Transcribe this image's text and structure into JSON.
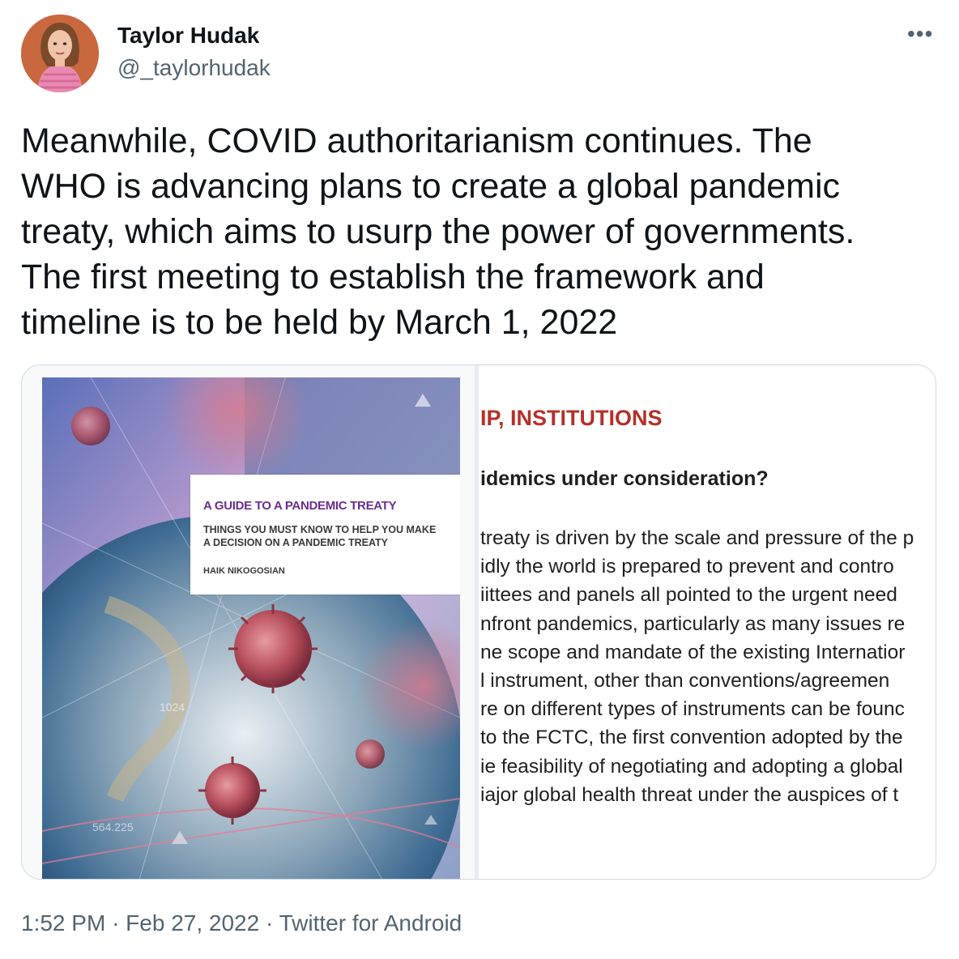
{
  "author": {
    "display_name": "Taylor Hudak",
    "handle": "@_taylorhudak"
  },
  "more_icon": "•••",
  "tweet_text_lines": [
    "Meanwhile, COVID authoritarianism continues. The",
    "WHO is advancing plans to create a global pandemic",
    "treaty, which aims to usurp the power of governments.",
    "The first meeting to establish the framework and",
    "timeline is to be held by March 1, 2022"
  ],
  "media": {
    "cover": {
      "title": "A GUIDE TO A PANDEMIC TREATY",
      "subtitle_lines": [
        "THINGS YOU MUST KNOW TO HELP YOU MAKE",
        "A DECISION ON A PANDEMIC TREATY"
      ],
      "author": "HAIK NIKOGOSIAN",
      "overlay_numbers": [
        "1024",
        "564.225"
      ]
    },
    "document": {
      "heading": "IP, INSTITUTIONS",
      "question": "idemics under consideration?",
      "lines": [
        "treaty is driven by the scale and pressure of the p",
        "idly the world is prepared to prevent and contro",
        "iittees and panels all pointed to the urgent need",
        "nfront pandemics, particularly as many issues re",
        "ne scope and mandate of the existing Internatior",
        "l instrument, other than conventions/agreemen",
        "re on different types of instruments can be founc",
        "to the FCTC, the first convention adopted by the",
        "ie feasibility of negotiating and adopting a global",
        "iajor global health threat under the auspices of t"
      ]
    }
  },
  "meta": {
    "time": "1:52 PM",
    "separator": "·",
    "date": "Feb 27, 2022",
    "source": "Twitter for Android"
  },
  "colors": {
    "primary_text": "#0f1419",
    "secondary_text": "#536471",
    "border": "#cfd9de",
    "cover_title": "#6b2d8c",
    "doc_heading": "#b5302a"
  }
}
